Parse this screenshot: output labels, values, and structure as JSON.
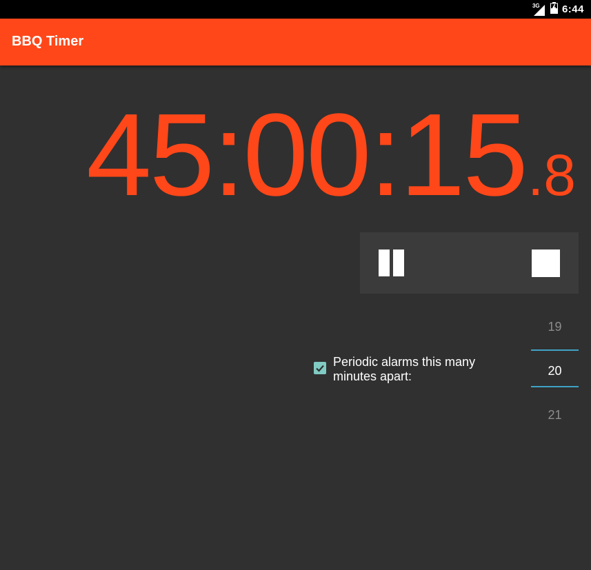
{
  "status_bar": {
    "network_type": "3G",
    "time": "6:44",
    "icons": [
      "signal-icon",
      "battery-charging-icon"
    ]
  },
  "app_bar": {
    "title": "BBQ Timer",
    "color": "#ff4719"
  },
  "timer": {
    "main": "45:00:15",
    "tenths": ".8",
    "color": "#ff4719"
  },
  "controls": {
    "pause_icon": "pause-icon",
    "stop_icon": "stop-icon"
  },
  "alarm": {
    "checked": true,
    "label": "Periodic alarms this many minutes apart:",
    "checkbox_color": "#80cbc4"
  },
  "minute_picker": {
    "previous": "19",
    "current": "20",
    "next": "21",
    "accent": "#3fa3c7"
  }
}
